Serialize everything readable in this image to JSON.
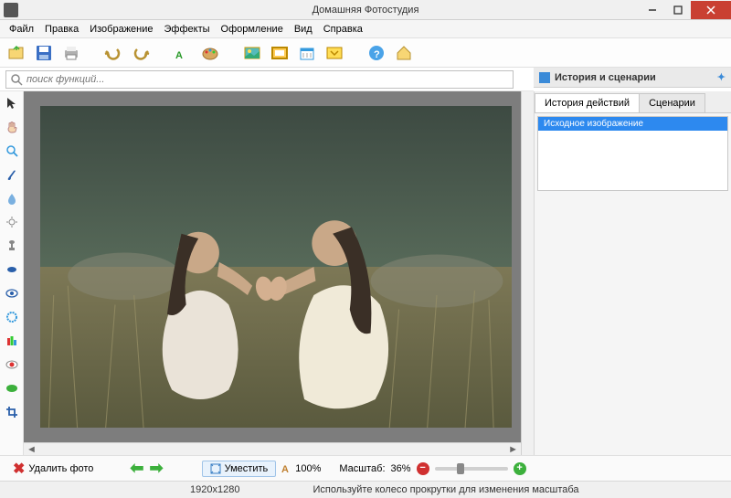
{
  "window": {
    "title": "Домашняя Фотостудия"
  },
  "menu": {
    "file": "Файл",
    "edit": "Правка",
    "image": "Изображение",
    "effects": "Эффекты",
    "design": "Оформление",
    "view": "Вид",
    "help": "Справка"
  },
  "search": {
    "placeholder": "поиск функций..."
  },
  "right_panel": {
    "title": "История и сценарии",
    "tab_history": "История действий",
    "tab_scenarios": "Сценарии",
    "item0": "Исходное изображение"
  },
  "bottom": {
    "delete": "Удалить фото",
    "fit": "Уместить",
    "zoom_full": "100%",
    "scale_label": "Масштаб:",
    "scale_value": "36%"
  },
  "status": {
    "dimensions": "1920x1280",
    "hint": "Используйте колесо прокрутки для изменения масштаба"
  }
}
